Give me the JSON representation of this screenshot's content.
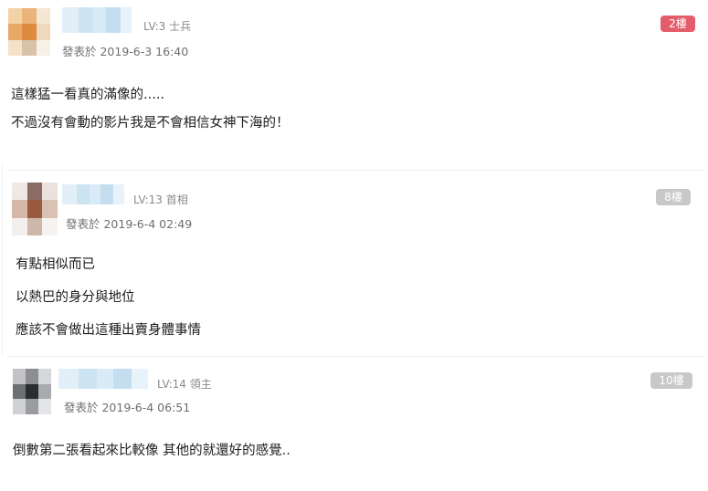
{
  "posts": [
    {
      "level": "LV:3 士兵",
      "date": "發表於 2019-6-3 16:40",
      "floor": "2樓",
      "floor_color": "#e35d6a",
      "lines": [
        "這樣猛一看真的滿像的.....",
        "不過沒有會動的影片我是不會相信女神下海的！"
      ],
      "avatar_colors": [
        "#f2d2a6",
        "#eab47a",
        "#f6e6d4",
        "#e8a865",
        "#dc8a3f",
        "#eed9bd",
        "#f4e1c7",
        "#d7c3a6",
        "#f8f1e7"
      ]
    },
    {
      "level": "LV:13 首相",
      "date": "發表於 2019-6-4 02:49",
      "floor": "8樓",
      "floor_color": "#c8c8c8",
      "lines": [
        "有點相似而已",
        "以熱巴的身分與地位",
        "應該不會做出這種出賣身體事情"
      ],
      "avatar_colors": [
        "#efe9e6",
        "#8a6c62",
        "#ebe2de",
        "#d6b8a9",
        "#9b5a3f",
        "#d9c2b4",
        "#f3efed",
        "#cdb7ab",
        "#f5f2f0"
      ]
    },
    {
      "level": "LV:14 領主",
      "date": "發表於 2019-6-4 06:51",
      "floor": "10樓",
      "floor_color": "#c8c8c8",
      "lines": [
        "倒數第二張看起來比較像 其他的就還好的感覺.."
      ],
      "avatar_colors": [
        "#c3c3c5",
        "#8d8e93",
        "#d6d7da",
        "#6e6f72",
        "#2b2c2f",
        "#a9aaae",
        "#d0d1d4",
        "#9b9c9f",
        "#e4e5e7"
      ]
    }
  ],
  "name_blur_colors": [
    "#e3eff8",
    "#cde4f3",
    "#d8ebf7",
    "#c4ddef",
    "#e8f2fa"
  ]
}
